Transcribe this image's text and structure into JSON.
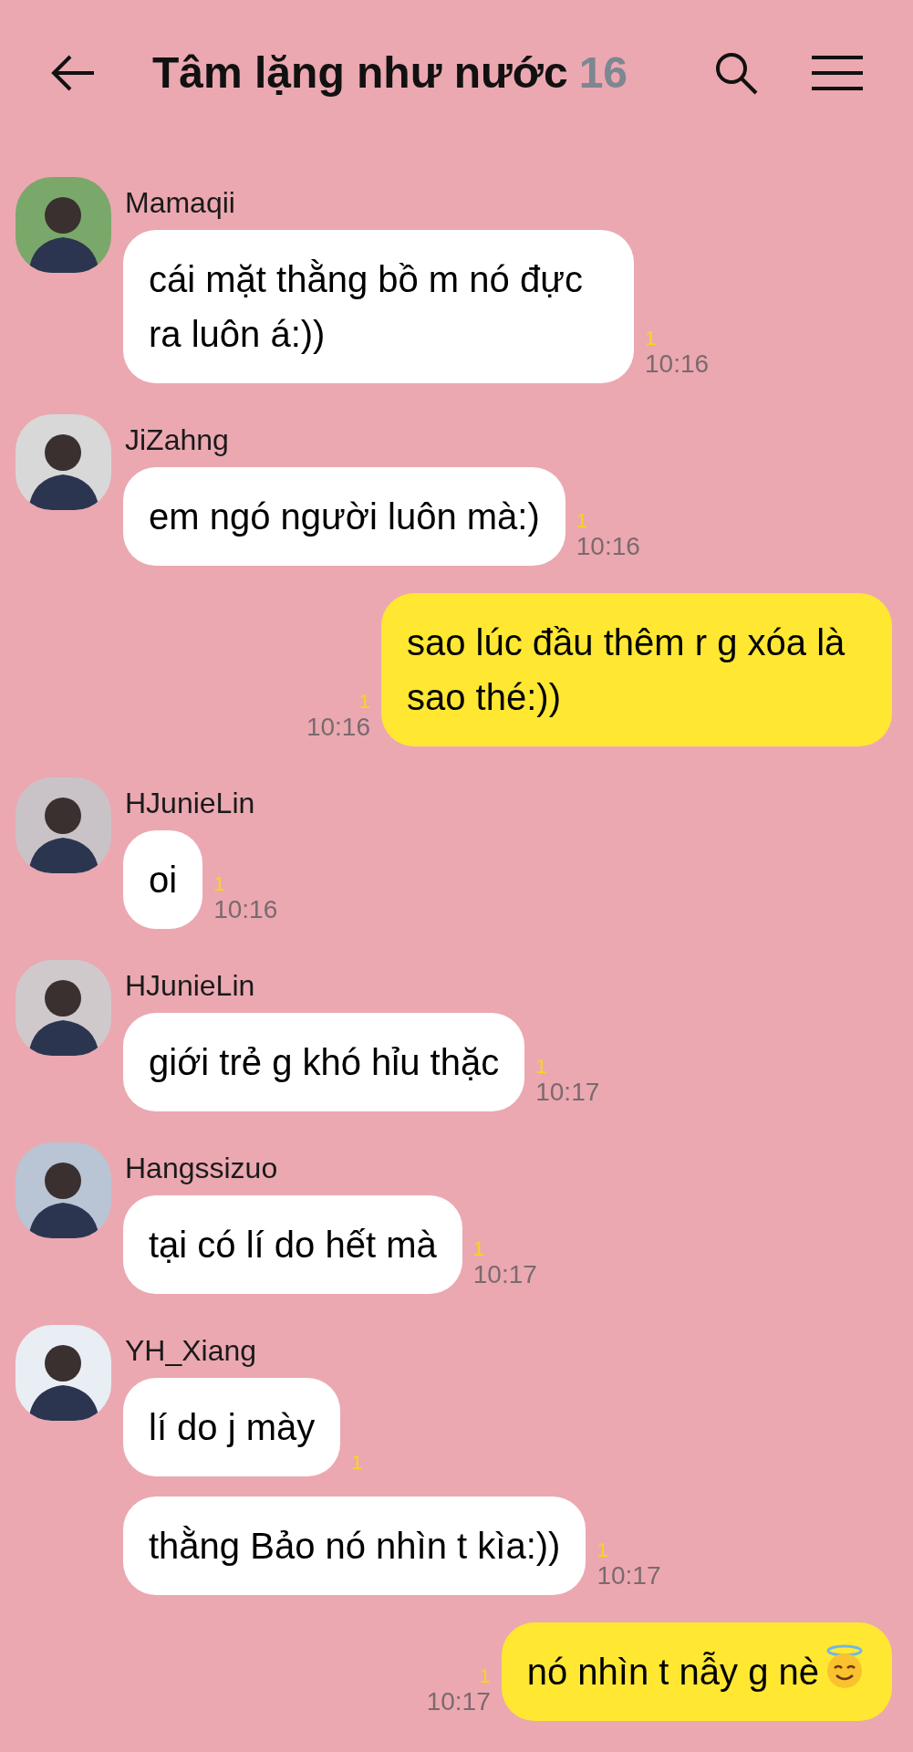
{
  "header": {
    "title": "Tâm lặng như nước",
    "member_count": "16"
  },
  "messages": [
    {
      "kind": "incoming",
      "sender": "Mamaqii",
      "text": "cái mặt thằng bồ m nó đực ra luôn á:))",
      "unread": "1",
      "time": "10:16"
    },
    {
      "kind": "incoming",
      "sender": "JiZahng",
      "text": "em ngó người luôn mà:)",
      "unread": "1",
      "time": "10:16"
    },
    {
      "kind": "outgoing",
      "text": "sao lúc đầu thêm r g xóa là sao thé:))",
      "unread": "1",
      "time": "10:16"
    },
    {
      "kind": "incoming",
      "sender": "HJunieLin",
      "text": "oi",
      "unread": "1",
      "time": "10:16"
    },
    {
      "kind": "incoming",
      "sender": "HJunieLin",
      "text": "giới trẻ g khó hỉu thặc",
      "unread": "1",
      "time": "10:17"
    },
    {
      "kind": "incoming",
      "sender": "Hangssizuo",
      "text": "tại có lí do hết mà",
      "unread": "1",
      "time": "10:17"
    },
    {
      "kind": "incoming",
      "sender": "YH_Xiang",
      "text": "lí do j mày",
      "unread": "1"
    },
    {
      "kind": "incoming",
      "text": "thằng Bảo nó nhìn t kìa:))",
      "unread": "1",
      "time": "10:17"
    },
    {
      "kind": "outgoing",
      "text": "nó nhìn t nẫy g nè",
      "emoji": true,
      "unread": "1",
      "time": "10:17"
    }
  ]
}
